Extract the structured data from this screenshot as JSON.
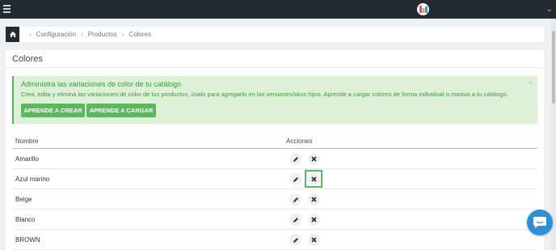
{
  "topbar": {
    "menu_icon": "hamburger-icon",
    "logo_icon": "brand-logo",
    "dropdown_icon": "chevron-down-icon"
  },
  "breadcrumb": {
    "home_icon": "home-icon",
    "items": [
      "Configuración",
      "Productos",
      "Colores"
    ]
  },
  "card": {
    "title": "Colores"
  },
  "alert": {
    "title": "Administra las variaciones de color de tu catálogo",
    "description": "Crea, edita y elimina las variaciones de color de tus productos, úsalo para agregarlo en las versiones/skus hijos. Aprende a cargar colores de forma individual o masiva a tu catálogo.",
    "close": "×",
    "btn_create": "APRENDE A CREAR",
    "btn_upload": "APRENDE A CARGAR"
  },
  "table": {
    "columns": [
      "Nombre",
      "Acciones"
    ],
    "rows": [
      {
        "name": "Amarillo"
      },
      {
        "name": "Azul marino"
      },
      {
        "name": "Beige"
      },
      {
        "name": "Blanco"
      },
      {
        "name": "BROWN"
      }
    ],
    "highlighted_delete_row": 1
  },
  "colors": {
    "topbar": "#232a31",
    "alert_bg": "#dff0d8",
    "alert_text": "#3c9a3c",
    "button_green": "#5cb85c",
    "chat_blue": "#2d8fd5"
  },
  "chat": {
    "icon": "chat-bubble-icon"
  }
}
